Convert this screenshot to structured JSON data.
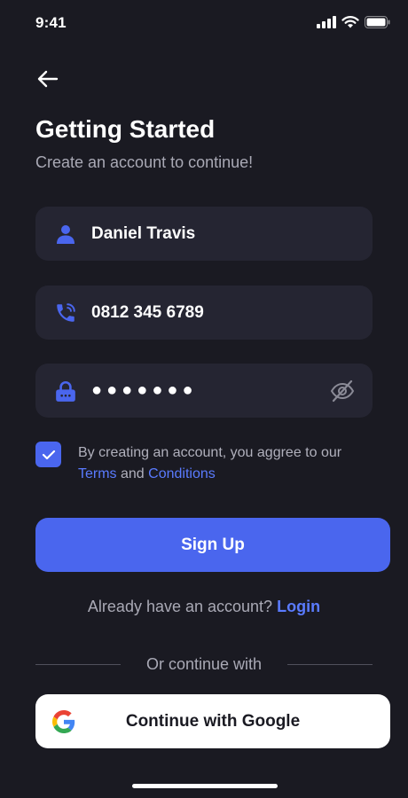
{
  "status_bar": {
    "time": "9:41",
    "icons": [
      "signal-icon",
      "wifi-icon",
      "battery-icon"
    ]
  },
  "header": {
    "back_icon": "arrow-left-icon",
    "title": "Getting Started",
    "subtitle": "Create an account to continue!"
  },
  "form": {
    "name": {
      "value": "Daniel Travis",
      "icon": "user-icon"
    },
    "phone": {
      "value": "0812 345 6789",
      "icon": "phone-icon"
    },
    "password": {
      "value": "●●●●●●●",
      "icon": "lock-icon",
      "toggle_icon": "eye-off-icon"
    }
  },
  "agreement": {
    "checked": true,
    "text_before": "By creating an account, you aggree to our ",
    "terms_link": "Terms",
    "text_and": " and ",
    "conditions_link": "Conditions"
  },
  "signup_button": "Sign Up",
  "login_prompt": {
    "text": "Already have an account? ",
    "link": "Login"
  },
  "divider_text": "Or continue with",
  "google_button": {
    "label": "Continue with Google",
    "icon": "google-icon"
  },
  "colors": {
    "background": "#1a1a22",
    "field": "#252532",
    "accent": "#4a66ee",
    "link": "#5a7bff",
    "muted_text": "#a9a9b5"
  }
}
